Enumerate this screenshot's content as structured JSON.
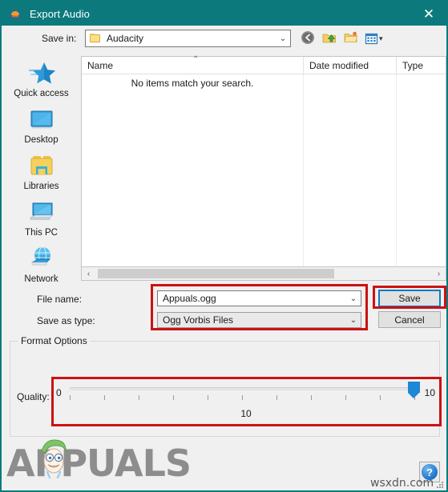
{
  "window": {
    "title": "Export Audio",
    "app_icon": "audacity-headphones-icon",
    "close_label": "✕",
    "frame_color": "#0c7a7d"
  },
  "savein": {
    "label": "Save in:",
    "value": "Audacity",
    "folder_icon": "folder-icon",
    "chevron": "⌄",
    "toolbar": [
      {
        "name": "back-icon",
        "title": "Back"
      },
      {
        "name": "up-one-level-icon",
        "title": "Up one level"
      },
      {
        "name": "new-folder-icon",
        "title": "Create New Folder"
      },
      {
        "name": "views-icon",
        "title": "Views"
      }
    ],
    "views_caret": "▾"
  },
  "places": [
    {
      "label": "Quick access",
      "icon": "quick-access-star-icon"
    },
    {
      "label": "Desktop",
      "icon": "desktop-monitor-icon"
    },
    {
      "label": "Libraries",
      "icon": "libraries-folder-icon"
    },
    {
      "label": "This PC",
      "icon": "this-pc-icon"
    },
    {
      "label": "Network",
      "icon": "network-globe-icon"
    }
  ],
  "filelist": {
    "columns": [
      "Name",
      "Date modified",
      "Type"
    ],
    "sort_indicator": "⌃",
    "empty_message": "No items match your search.",
    "rows": []
  },
  "hscrollbar": {
    "left_arrow": "‹",
    "right_arrow": "›"
  },
  "form": {
    "filename_label": "File name:",
    "filename_value": "Appuals.ogg",
    "savetype_label": "Save as type:",
    "savetype_value": "Ogg Vorbis Files",
    "chevron": "⌄",
    "save_label": "Save",
    "cancel_label": "Cancel"
  },
  "format_options": {
    "legend": "Format Options",
    "quality_label": "Quality:",
    "min_label": "0",
    "max_label": "10",
    "value_label": "10",
    "tick_count": 11,
    "accent_color": "#1e87d6"
  },
  "annotations": {
    "color": "#cc1111",
    "boxes": [
      "file-fields",
      "save-button",
      "quality-slider"
    ]
  },
  "footer": {
    "watermark_text": "APPUALS",
    "mascot_icon": "appuals-mascot-icon",
    "help_label": "?",
    "site_text": "wsxdn.com"
  }
}
